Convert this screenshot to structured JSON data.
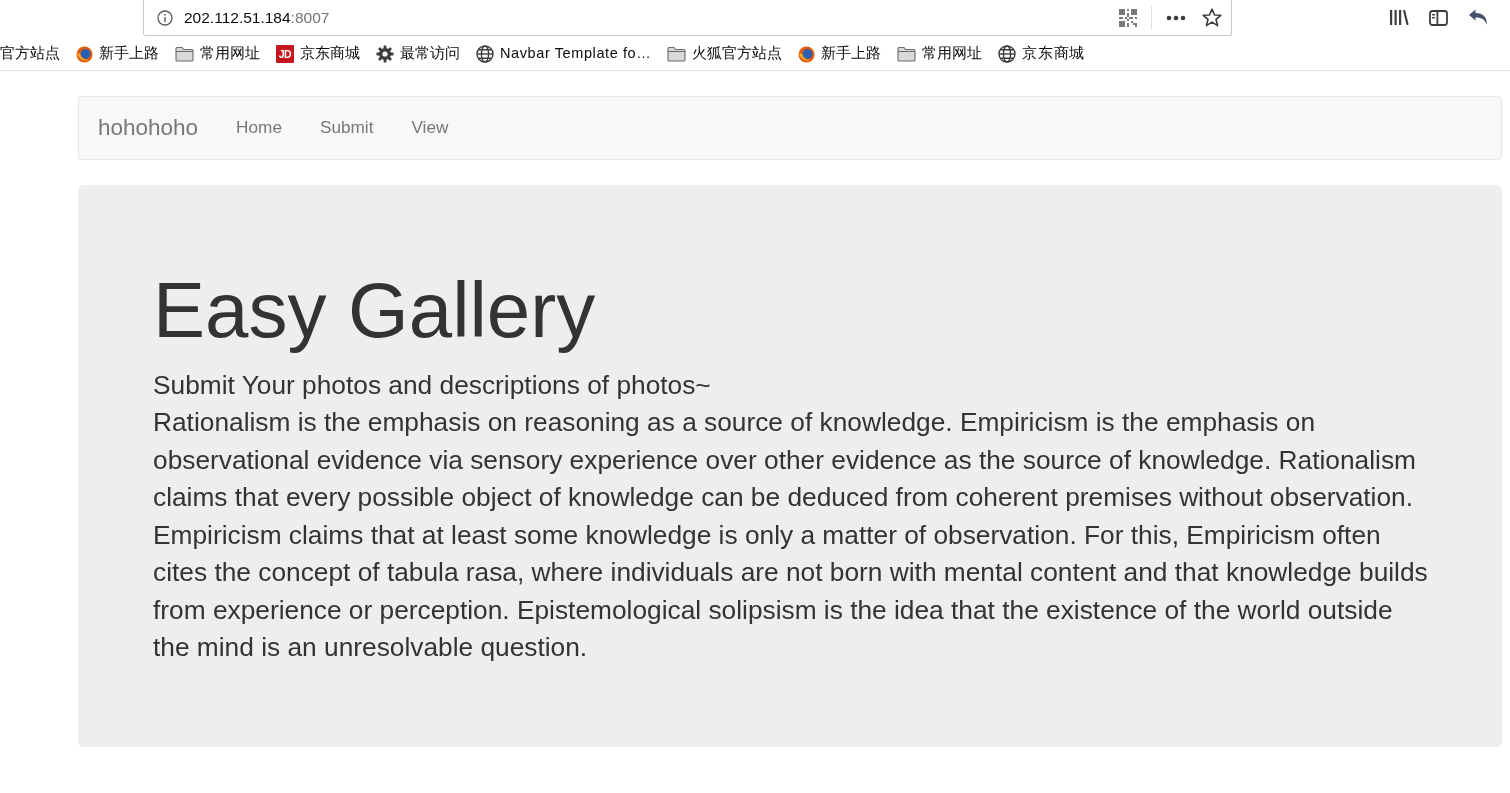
{
  "browser": {
    "address_bar": {
      "host": "202.112.51.184",
      "port": ":8007"
    },
    "bookmarks": [
      {
        "kind": "plain",
        "label": "官方站点"
      },
      {
        "kind": "firefox",
        "label": "新手上路"
      },
      {
        "kind": "folder",
        "label": "常用网址"
      },
      {
        "kind": "jd",
        "logo": "JD",
        "label": "京东商城"
      },
      {
        "kind": "gear",
        "label": "最常访问"
      },
      {
        "kind": "globe",
        "label": "Navbar Template fo…"
      },
      {
        "kind": "folder",
        "label": "火狐官方站点"
      },
      {
        "kind": "firefox",
        "label": "新手上路"
      },
      {
        "kind": "folder",
        "label": "常用网址"
      },
      {
        "kind": "globe",
        "label": "京东商城"
      }
    ]
  },
  "navbar": {
    "brand": "hohohoho",
    "links": [
      {
        "label": "Home"
      },
      {
        "label": "Submit"
      },
      {
        "label": "View"
      }
    ]
  },
  "jumbotron": {
    "title": "Easy Gallery",
    "tagline": "Submit Your photos and descriptions of photos~",
    "text": "Rationalism is the emphasis on reasoning as a source of knowledge. Empiricism is the emphasis on observational evidence via sensory experience over other evidence as the source of knowledge. Rationalism claims that every possible object of knowledge can be deduced from coherent premises without observation. Empiricism claims that at least some knowledge is only a matter of observation. For this, Empiricism often cites the concept of tabula rasa, where individuals are not born with mental content and that knowledge builds from experience or perception. Epistemological solipsism is the idea that the existence of the world outside the mind is an unresolvable question."
  }
}
